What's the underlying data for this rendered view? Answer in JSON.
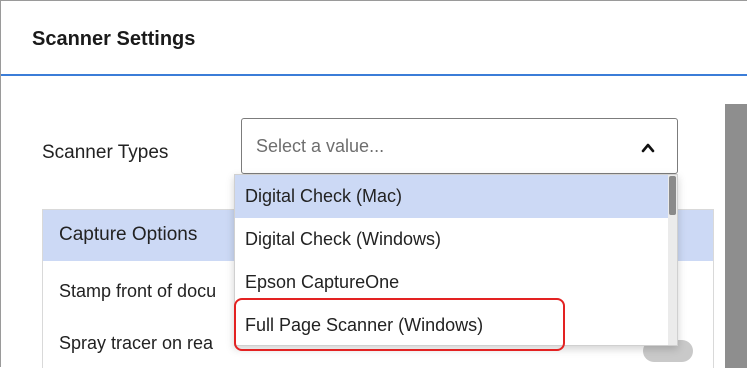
{
  "header": {
    "title": "Scanner Settings"
  },
  "scanner_types": {
    "label": "Scanner Types",
    "placeholder": "Select a value..."
  },
  "dropdown": {
    "options": [
      {
        "label": "Digital Check (Mac)"
      },
      {
        "label": "Digital Check (Windows)"
      },
      {
        "label": "Epson CaptureOne"
      },
      {
        "label": "Full Page Scanner (Windows)"
      }
    ],
    "highlighted_option": "Full Page Scanner (Windows)"
  },
  "capture_options": {
    "title": "Capture Options",
    "items": [
      {
        "label": "Stamp front of docu"
      },
      {
        "label": "Spray tracer on rea"
      }
    ]
  },
  "colors": {
    "accent": "#3b7dd8",
    "selection": "#ccd9f5",
    "highlight": "#e32222"
  },
  "icons": {
    "chevron": "chevron-up-icon"
  }
}
